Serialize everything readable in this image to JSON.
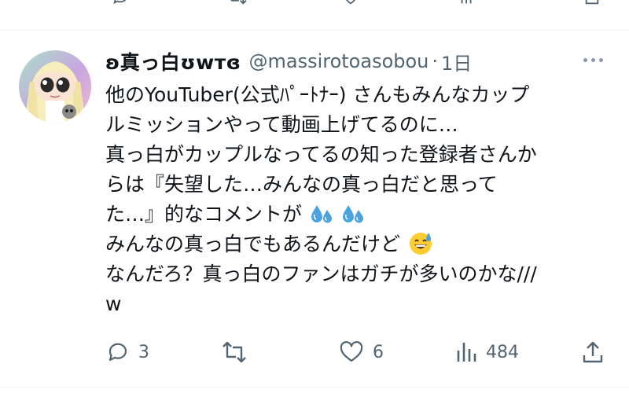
{
  "tweet": {
    "display_name": "ʚ真っ白ʊᴡᴛɞ",
    "handle": "@massirotoasobou",
    "separator": "·",
    "time": "1日",
    "lines": [
      "他のYouTuber(公式ﾊﾟｰﾄﾅｰ) さんもみんなカップ",
      "ルミッションやって動画上げてるのに…",
      "真っ白がカップルなってるの知った登録者さんか",
      "らは『失望した…みんなの真っ白だと思って",
      "た…』的なコメントが",
      "みんなの真っ白でもあるんだけど",
      "なんだろ？真っ白のファンはガチが多いのかな///",
      "w"
    ],
    "emojis": {
      "line5": [
        "sweat-droplets-emoji",
        "sweat-droplets-emoji"
      ],
      "line6": [
        "grinning-face-with-sweat-emoji"
      ]
    }
  },
  "actions": {
    "reply_count": "3",
    "retweet_count": "",
    "like_count": "6",
    "view_count": "484"
  },
  "icons": [
    "reply-icon",
    "retweet-icon",
    "like-icon",
    "views-icon",
    "share-icon",
    "more-icon"
  ],
  "colors": {
    "text": "#0f1419",
    "muted": "#536471",
    "divider": "#eff3f4",
    "emoji_blue": "#4aa3df",
    "emoji_yellow": "#ffcc33"
  }
}
